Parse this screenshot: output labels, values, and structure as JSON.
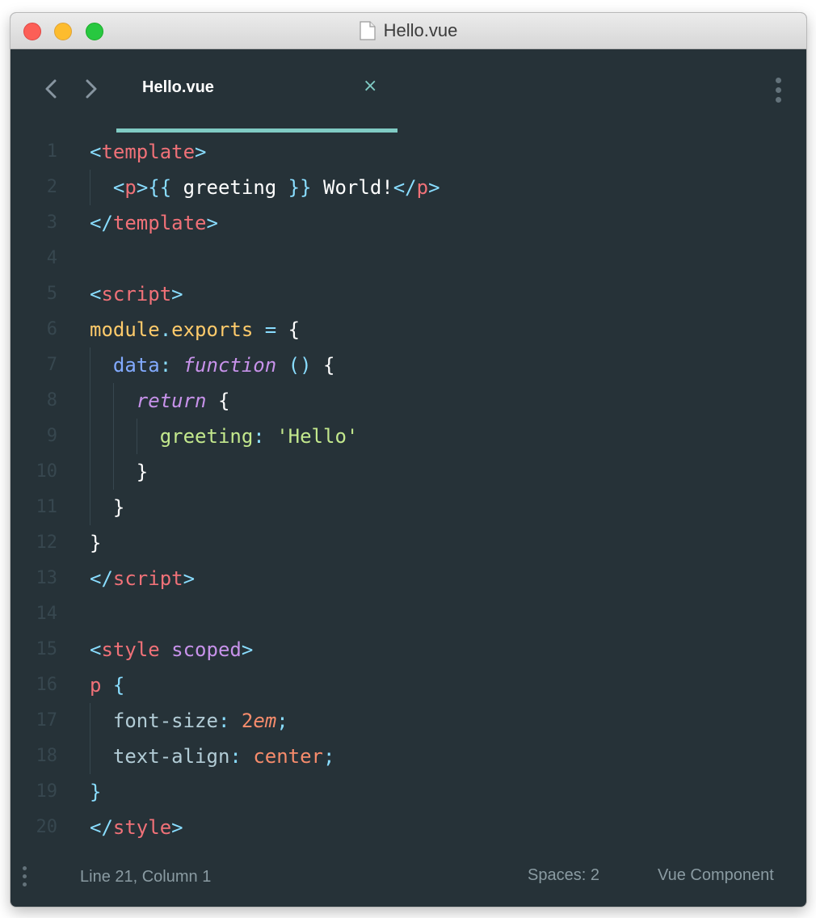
{
  "window": {
    "title": "Hello.vue"
  },
  "tabs": [
    {
      "label": "Hello.vue",
      "close_glyph": "×",
      "active": true
    }
  ],
  "icons": {
    "back": "chevron-left-icon",
    "forward": "chevron-right-icon",
    "file": "document-icon",
    "menu": "vertical-dots-icon",
    "close_tab": "close-icon"
  },
  "colors": {
    "background": "#263238",
    "accent": "#80cbc4",
    "tag": "#f07178",
    "punctuation": "#89ddff",
    "variable": "#ffcb6b",
    "property": "#82aaff",
    "keyword": "#c792ea",
    "string": "#c3e88d",
    "number": "#f78c6c",
    "line_number": "#37474f"
  },
  "editor": {
    "lines": [
      {
        "number": "1",
        "tokens": [
          [
            "<",
            "punct"
          ],
          [
            "template",
            "tag"
          ],
          [
            ">",
            "punct"
          ]
        ]
      },
      {
        "number": "2",
        "tokens": [
          [
            "  ",
            "white"
          ],
          [
            "<",
            "punct"
          ],
          [
            "p",
            "tag"
          ],
          [
            ">",
            "punct"
          ],
          [
            "{{",
            "punct"
          ],
          [
            " greeting ",
            "white"
          ],
          [
            "}}",
            "punct"
          ],
          [
            " World!",
            "white"
          ],
          [
            "</",
            "punct"
          ],
          [
            "p",
            "tag"
          ],
          [
            ">",
            "punct"
          ]
        ]
      },
      {
        "number": "3",
        "tokens": [
          [
            "</",
            "punct"
          ],
          [
            "template",
            "tag"
          ],
          [
            ">",
            "punct"
          ]
        ]
      },
      {
        "number": "4",
        "tokens": []
      },
      {
        "number": "5",
        "tokens": [
          [
            "<",
            "punct"
          ],
          [
            "script",
            "tag"
          ],
          [
            ">",
            "punct"
          ]
        ]
      },
      {
        "number": "6",
        "tokens": [
          [
            "module",
            "var"
          ],
          [
            ".",
            "punct"
          ],
          [
            "exports",
            "var"
          ],
          [
            " ",
            "white"
          ],
          [
            "=",
            "punct"
          ],
          [
            " {",
            "white"
          ]
        ]
      },
      {
        "number": "7",
        "tokens": [
          [
            "  ",
            "white"
          ],
          [
            "data",
            "prop"
          ],
          [
            ":",
            "punct"
          ],
          [
            " ",
            "white"
          ],
          [
            "function",
            "kw"
          ],
          [
            " ",
            "white"
          ],
          [
            "()",
            "punct"
          ],
          [
            " {",
            "white"
          ]
        ]
      },
      {
        "number": "8",
        "tokens": [
          [
            "    ",
            "white"
          ],
          [
            "return",
            "kw"
          ],
          [
            " {",
            "white"
          ]
        ]
      },
      {
        "number": "9",
        "tokens": [
          [
            "      ",
            "white"
          ],
          [
            "greeting",
            "str"
          ],
          [
            ":",
            "punct"
          ],
          [
            " ",
            "white"
          ],
          [
            "'Hello'",
            "str"
          ]
        ]
      },
      {
        "number": "10",
        "tokens": [
          [
            "    ",
            "white"
          ],
          [
            "}",
            "white"
          ]
        ]
      },
      {
        "number": "11",
        "tokens": [
          [
            "  ",
            "white"
          ],
          [
            "}",
            "white"
          ]
        ]
      },
      {
        "number": "12",
        "tokens": [
          [
            "}",
            "white"
          ]
        ]
      },
      {
        "number": "13",
        "tokens": [
          [
            "</",
            "punct"
          ],
          [
            "script",
            "tag"
          ],
          [
            ">",
            "punct"
          ]
        ]
      },
      {
        "number": "14",
        "tokens": []
      },
      {
        "number": "15",
        "tokens": [
          [
            "<",
            "punct"
          ],
          [
            "style",
            "tag"
          ],
          [
            " ",
            "white"
          ],
          [
            "scoped",
            "attr"
          ],
          [
            ">",
            "punct"
          ]
        ]
      },
      {
        "number": "16",
        "tokens": [
          [
            "p",
            "tag"
          ],
          [
            " ",
            "white"
          ],
          [
            "{",
            "punct"
          ]
        ]
      },
      {
        "number": "17",
        "tokens": [
          [
            "  ",
            "white"
          ],
          [
            "font-size",
            "css"
          ],
          [
            ":",
            "punct"
          ],
          [
            " ",
            "white"
          ],
          [
            "2",
            "num"
          ],
          [
            "em",
            "unit"
          ],
          [
            ";",
            "punct"
          ]
        ]
      },
      {
        "number": "18",
        "tokens": [
          [
            "  ",
            "white"
          ],
          [
            "text-align",
            "css"
          ],
          [
            ":",
            "punct"
          ],
          [
            " ",
            "white"
          ],
          [
            "center",
            "num"
          ],
          [
            ";",
            "punct"
          ]
        ]
      },
      {
        "number": "19",
        "tokens": [
          [
            "}",
            "punct"
          ]
        ]
      },
      {
        "number": "20",
        "tokens": [
          [
            "</",
            "punct"
          ],
          [
            "style",
            "tag"
          ],
          [
            ">",
            "punct"
          ]
        ]
      }
    ]
  },
  "status": {
    "position": "Line 21, Column 1",
    "spaces": "Spaces: 2",
    "syntax": "Vue Component"
  }
}
